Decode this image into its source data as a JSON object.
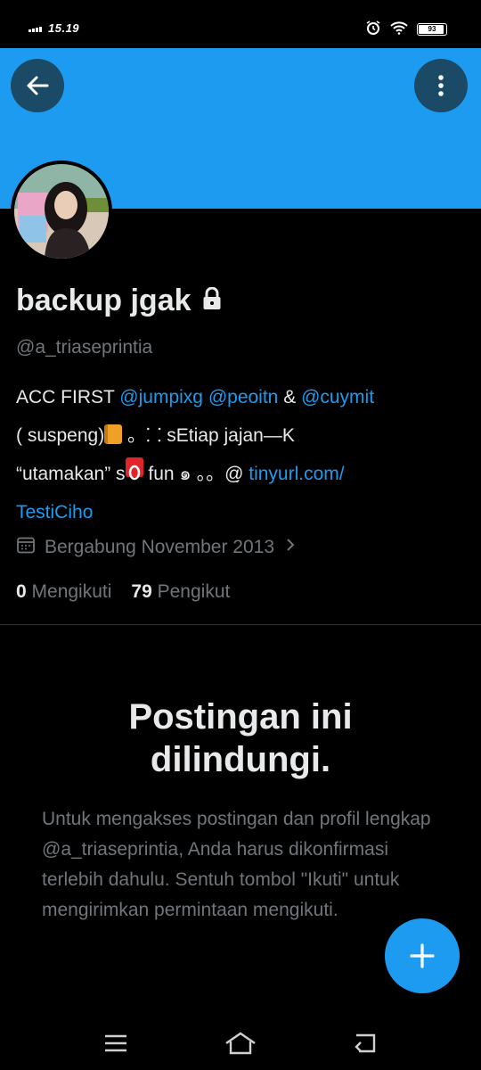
{
  "status_bar": {
    "time": "15.19",
    "battery_percent": 93,
    "battery_text": "93",
    "icons": [
      "signal-icon",
      "alarm-icon",
      "wifi-icon",
      "battery-icon"
    ]
  },
  "header": {
    "banner_color": "#1d9bf0",
    "back_icon": "arrow-left-icon",
    "more_icon": "more-vertical-icon"
  },
  "profile": {
    "display_name": "backup jgak",
    "lock_icon": "lock-icon",
    "handle": "@a_triaseprintia",
    "bio": {
      "line1": {
        "text1": "ACC FIRST ",
        "mention1": "@jumpixg",
        "mention2": "@peoitn",
        "text2": " & ",
        "mention3": "@cuymit"
      },
      "line2": {
        "text": "( suspeng)",
        "text2": " 。⸬ sEtiap jajan—K"
      },
      "line3": {
        "text1": "“utamakan” s",
        "text2": " fun ๑ 。。@̣ ",
        "link": "tinyurl.com/"
      },
      "line4": {
        "link": "TestiCiho"
      }
    },
    "joined": "Bergabung November 2013",
    "following_count": "0",
    "following_label": "Mengikuti",
    "followers_count": "79",
    "followers_label": "Pengikut"
  },
  "protected": {
    "title_line1": "Postingan ini",
    "title_line2": "dilindungi.",
    "body": "Untuk mengakses postingan dan profil lengkap @a_triaseprintia, Anda harus dikonfirmasi terlebih dahulu. Sentuh tombol \"Ikuti\" untuk mengirimkan permintaan mengikuti."
  },
  "fab": {
    "icon": "plus-icon"
  },
  "nav_bar": {
    "icons": [
      "menu-icon",
      "home-icon",
      "back-icon"
    ]
  },
  "colors": {
    "accent": "#1d9bf0",
    "background": "#000000",
    "muted": "#71767b",
    "text": "#e7e9ea"
  }
}
